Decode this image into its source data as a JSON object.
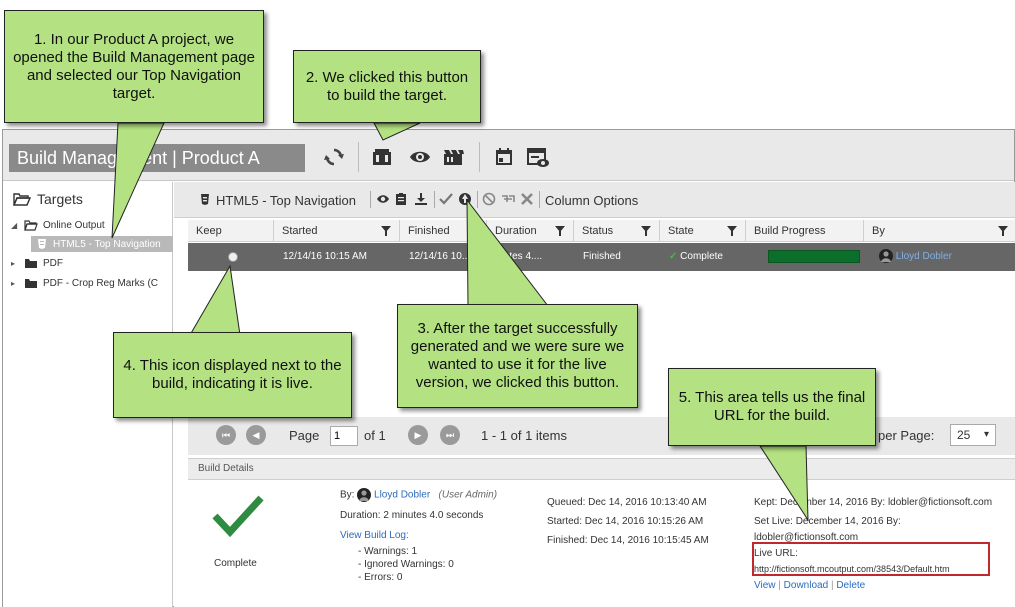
{
  "header": {
    "title": "Build Management  |  Product A",
    "title_visible": "Build Mana",
    "title_visible_tail": "ent  |  Product A"
  },
  "sidebar": {
    "title": "Targets",
    "items": [
      {
        "label": "Online Output",
        "expanded": true
      },
      {
        "label": "HTML5 - Top Navigation",
        "selected": true
      },
      {
        "label": "PDF"
      },
      {
        "label": "PDF - Crop Reg Marks (C"
      }
    ]
  },
  "toolbar": {
    "target_label": "HTML5 - Top Navigation",
    "column_options": "Column Options"
  },
  "table": {
    "columns": [
      "Keep",
      "Started",
      "Finished",
      "Duration",
      "Status",
      "State",
      "Build Progress",
      "By"
    ],
    "rows": [
      {
        "started": "12/14/16 10:15 AM",
        "finished": "12/14/16 10...",
        "duration": "inutes 4....",
        "status": "Finished",
        "state": "Complete",
        "progress": 1.0,
        "by": "Lloyd Dobler"
      }
    ]
  },
  "pager": {
    "page_label": "Page",
    "page_value": "1",
    "of_label": "of 1",
    "items_label": "1 - 1 of 1 items",
    "per_page_label": "per Page:",
    "per_page_value": "25"
  },
  "build_details": {
    "heading": "Build Details",
    "status": "Complete",
    "by_label": "By:",
    "by_name": "Lloyd Dobler",
    "by_role": "(User Admin)",
    "duration": "Duration: 2 minutes 4.0 seconds",
    "view_log": "View Build Log:",
    "warnings": "- Warnings: 1",
    "ignored": "- Ignored Warnings: 0",
    "errors": "- Errors: 0",
    "queued": "Queued: Dec 14, 2016 10:13:40 AM",
    "started": "Started: Dec 14, 2016 10:15:26 AM",
    "finished": "Finished: Dec 14, 2016 10:15:45 AM",
    "kept": "Kept: December 14, 2016 By: ldobler@fictionsoft.com",
    "set_live": "Set Live: December 14, 2016 By:",
    "set_live_email": "ldobler@fictionsoft.com",
    "live_url_label": "Live URL:",
    "live_url": "http://fictionsoft.mcoutput.com/38543/Default.htm",
    "view_link": "View",
    "download_link": "Download",
    "delete_link": "Delete",
    "link_sep": "|"
  },
  "callouts": {
    "c1": "1. In our Product A project, we opened the Build Management page and selected our Top Navigation target.",
    "c2": "2. We clicked this button to build the target.",
    "c3": "3. After the target successfully generated and we were sure we wanted to use it for the live version, we clicked this button.",
    "c4": "4. This icon displayed next to the build, indicating it is live.",
    "c5": "5. This area tells us the final URL for the build."
  },
  "colors": {
    "callout": "#b4e282",
    "progress": "#0b6e2b",
    "selected_row": "#666666",
    "url_box": "#c0282b"
  }
}
